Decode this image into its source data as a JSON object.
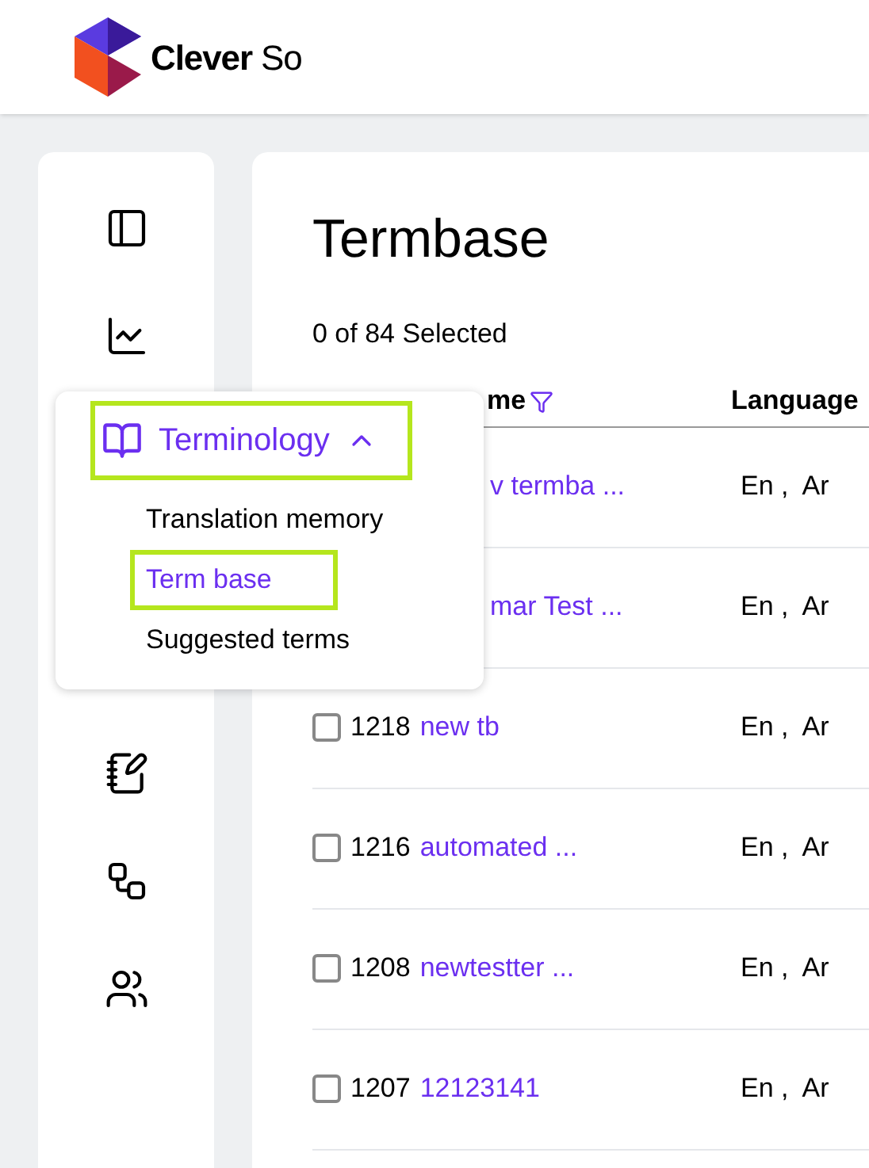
{
  "brand": {
    "name_bold": "Clever",
    "name_light": "So"
  },
  "page": {
    "title": "Termbase",
    "selection_count": "0 of 84 Selected"
  },
  "table": {
    "columns": [
      {
        "label": "me",
        "filter": true
      },
      {
        "label": "Language",
        "filter": false
      }
    ],
    "rows": [
      {
        "name": "v termba ...",
        "language": "En ,  Ar"
      },
      {
        "name": "mar Test ...",
        "language": "En ,  Ar"
      },
      {
        "id": "1218",
        "checked": false,
        "name": "new tb",
        "language": "En ,  Ar"
      },
      {
        "id": "1216",
        "checked": false,
        "name": "automated ...",
        "language": "En ,  Ar"
      },
      {
        "id": "1208",
        "checked": false,
        "name": "newtestter ...",
        "language": "En ,  Ar"
      },
      {
        "id": "1207",
        "checked": false,
        "name": "12123141",
        "language": "En ,  Ar"
      }
    ]
  },
  "menu": {
    "label": "Terminology",
    "expanded": true,
    "highlighted": true,
    "items": [
      {
        "label": "Translation memory",
        "selected": false,
        "highlighted": false
      },
      {
        "label": "Term base",
        "selected": true,
        "highlighted": true
      },
      {
        "label": "Suggested terms",
        "selected": false,
        "highlighted": false
      }
    ]
  }
}
